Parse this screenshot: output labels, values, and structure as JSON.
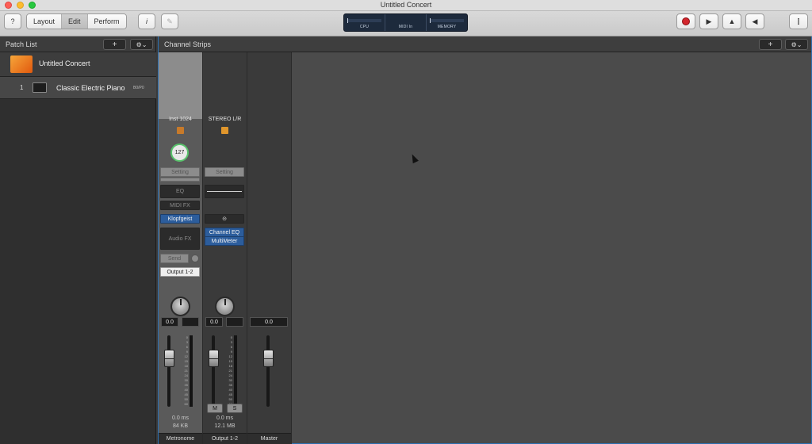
{
  "window": {
    "title": "Untitled Concert"
  },
  "toolbar": {
    "help_glyph": "?",
    "modes": [
      {
        "label": "Layout",
        "active": false
      },
      {
        "label": "Edit",
        "active": true
      },
      {
        "label": "Perform",
        "active": false
      }
    ],
    "info_glyph": "i",
    "tuner_glyph": "✎",
    "lcd": [
      {
        "label": "CPU"
      },
      {
        "label": "MIDI In"
      },
      {
        "label": "MEMORY"
      }
    ],
    "play_glyph": "▶",
    "metronome_glyph": "▲",
    "speaker_glyph": "◀",
    "mixer_glyph": "⫿",
    "accent_record": "#d3262d"
  },
  "patch_list": {
    "title": "Patch List",
    "add_glyph": "+",
    "gear_glyph": "⚙⌄",
    "concert": "Untitled Concert",
    "patches": [
      {
        "number": "1",
        "name": "Classic Electric Piano",
        "tag": "B0/P0"
      }
    ]
  },
  "channel_strips": {
    "title": "Channel Strips",
    "add_glyph": "+",
    "gear_glyph": "⚙⌄",
    "strips": [
      {
        "name": "Inst 1024",
        "knob_value": "127",
        "setting": "Setting",
        "eq": "EQ",
        "midi_fx": "MIDI FX",
        "plugin": "Klopfgeist",
        "audio_fx": "Audio FX",
        "send": "Send",
        "output": "Output 1-2",
        "volume": "0.0",
        "latency": "0.0 ms",
        "memory": "84 KB",
        "footer": "Metronome"
      },
      {
        "name": "STEREO L/R",
        "setting": "Setting",
        "link_glyph": "⊝",
        "plugins": [
          "Channel EQ",
          "MultiMeter"
        ],
        "volume": "0.0",
        "mute": "M",
        "solo": "S",
        "latency": "0.0 ms",
        "memory": "12.1 MB",
        "footer": "Output 1-2"
      },
      {
        "volume": "0.0",
        "footer": "Master"
      }
    ],
    "meter_scale": [
      "0",
      "3",
      "6",
      "9",
      "12",
      "15",
      "18",
      "21",
      "24",
      "30",
      "35",
      "40",
      "45",
      "50",
      "60"
    ]
  }
}
